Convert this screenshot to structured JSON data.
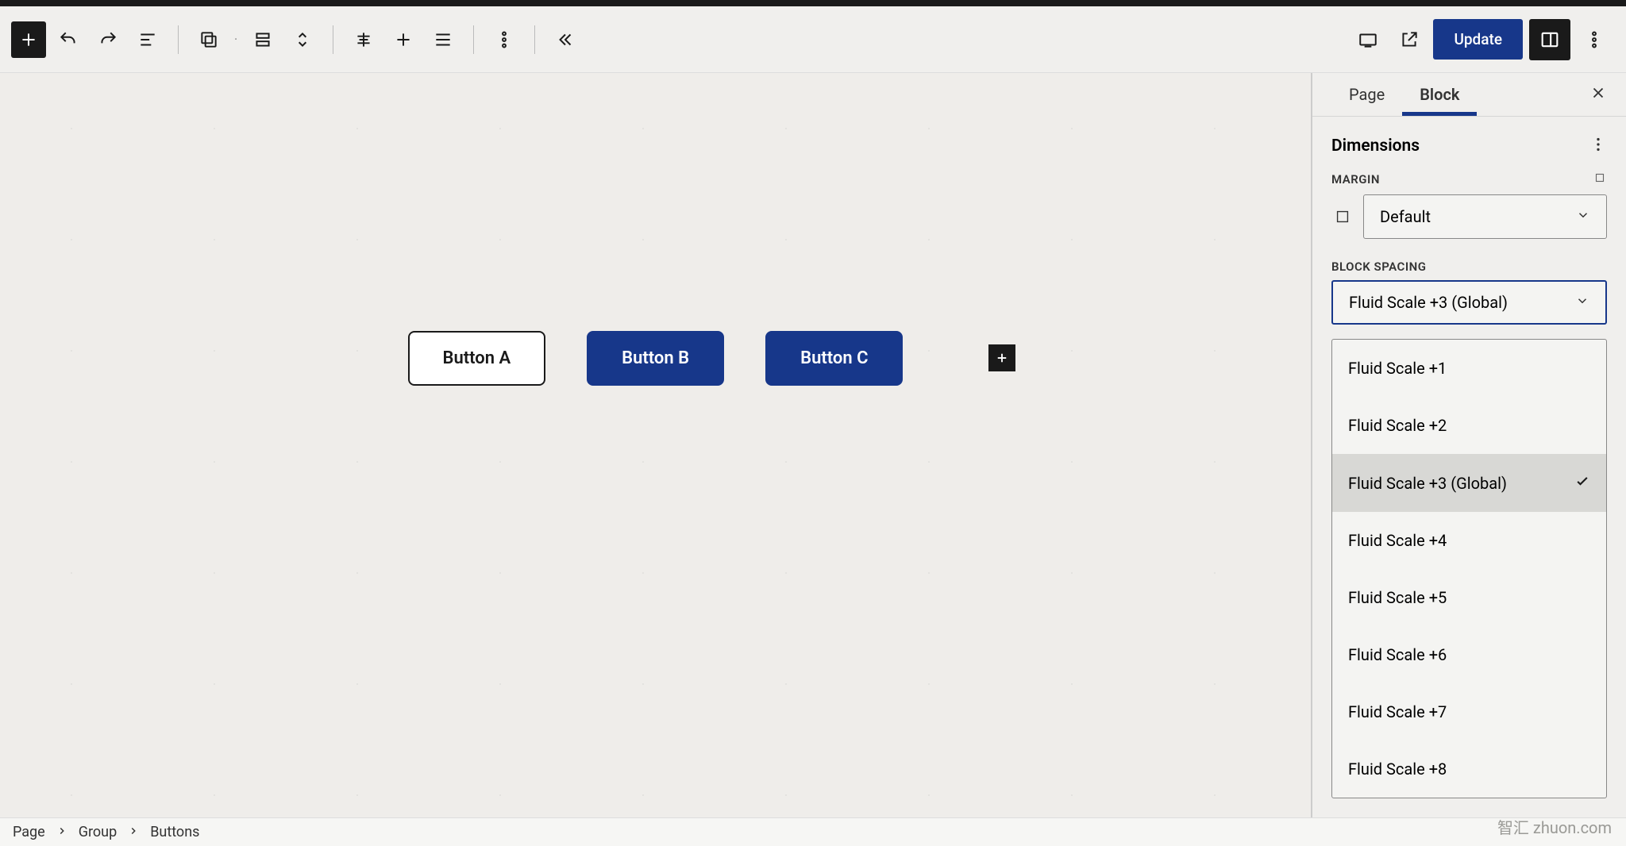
{
  "toolbar": {
    "update_label": "Update"
  },
  "canvas": {
    "buttons": [
      "Button A",
      "Button B",
      "Button C"
    ]
  },
  "sidebar": {
    "tabs": {
      "page": "Page",
      "block": "Block"
    },
    "dimensions": {
      "title": "Dimensions",
      "margin_label": "MARGIN",
      "margin_value": "Default",
      "block_spacing_label": "BLOCK SPACING",
      "block_spacing_value": "Fluid Scale +3 (Global)",
      "options": [
        "Fluid Scale +1",
        "Fluid Scale +2",
        "Fluid Scale +3 (Global)",
        "Fluid Scale +4",
        "Fluid Scale +5",
        "Fluid Scale +6",
        "Fluid Scale +7",
        "Fluid Scale +8"
      ],
      "selected_index": 2
    }
  },
  "breadcrumb": [
    "Page",
    "Group",
    "Buttons"
  ],
  "watermark": "智汇 zhuon.com"
}
